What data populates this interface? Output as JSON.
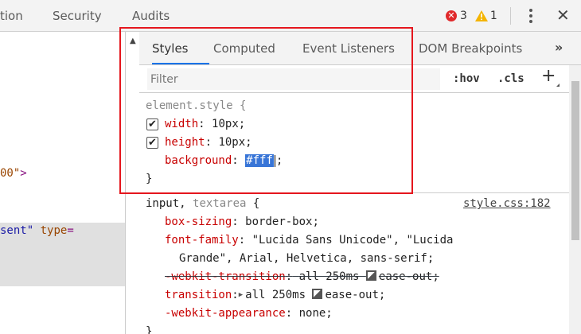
{
  "topbar": {
    "tabs": [
      "tion",
      "Security",
      "Audits"
    ],
    "error_count": "3",
    "error_icon": "✕",
    "warning_count": "1",
    "more_icon": "kebab-menu-icon",
    "close_label": "✕"
  },
  "left": {
    "src1_text": "00\"",
    "src1_close": ">",
    "src2_str": "sent\"",
    "src2_attr": "type",
    "src2_eq": "="
  },
  "styles": {
    "scroll_up_arrow": "▲",
    "tabs": [
      "Styles",
      "Computed",
      "Event Listeners",
      "DOM Breakpoints"
    ],
    "more_tabs": "»",
    "filter_placeholder": "Filter",
    "hov": ":hov",
    "cls": ".cls",
    "plus": "+",
    "element_rule": {
      "selector": "element.style {",
      "props": [
        {
          "name": "width",
          "value": "10px;",
          "checked": true
        },
        {
          "name": "height",
          "value": "10px;",
          "checked": true
        },
        {
          "name": "background",
          "value": "#fff",
          "value_suffix": ";",
          "selected": true
        }
      ],
      "close": "}"
    },
    "input_rule": {
      "selector_main": "input,",
      "selector_dim": "textarea",
      "brace": "{",
      "source": "style.css:182",
      "lines": [
        {
          "name": "box-sizing",
          "value": "border-box;"
        },
        {
          "name": "font-family",
          "value": "\"Lucida Sans Unicode\", \"Lucida"
        },
        {
          "continuation": "Grande\", Arial, Helvetica, sans-serif;"
        },
        {
          "name": "-webkit-transition",
          "value_pre": "all 250ms",
          "value_post": "ease-out;",
          "struck": true
        },
        {
          "name": "transition",
          "value_pre": "all 250ms",
          "value_post": "ease-out;"
        },
        {
          "name": "-webkit-appearance",
          "value": "none;"
        }
      ],
      "close": "}"
    },
    "check_mark": "✔",
    "colon": ":",
    "expand_triangle": "▶"
  }
}
